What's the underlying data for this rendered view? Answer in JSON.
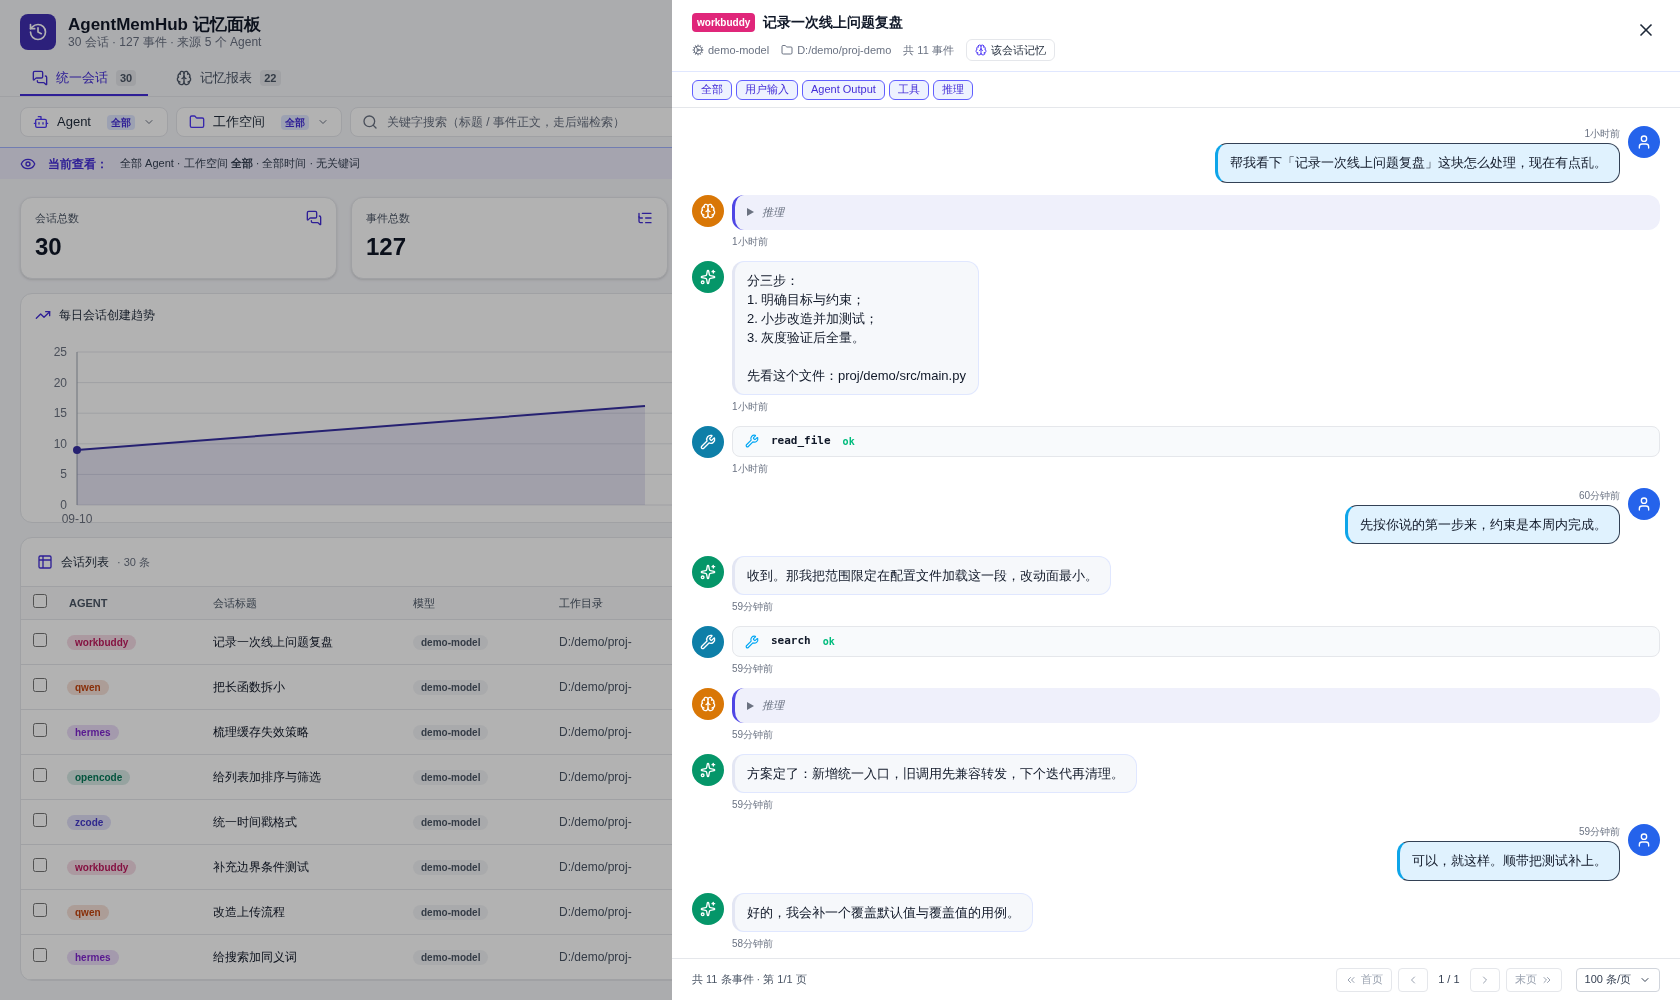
{
  "app": {
    "title": "AgentMemHub 记忆面板",
    "subtitle": "30 会话 · 127 事件 · 来源 5 个 Agent"
  },
  "tabs": [
    {
      "label": "统一会话",
      "count": "30",
      "selected": true
    },
    {
      "label": "记忆报表",
      "count": "22",
      "selected": false
    }
  ],
  "filters": [
    {
      "kind": "agent",
      "label": "Agent",
      "value": "全部"
    },
    {
      "kind": "workspace",
      "label": "工作空间",
      "value": "全部"
    }
  ],
  "search": {
    "placeholder": "关键字搜索（标题 / 事件正文，走后端检索）"
  },
  "viewing": {
    "label": "当前查看：",
    "text": "全部 Agent · 工作空间 **全部** · 全部时间 · 无关键词"
  },
  "stats": [
    {
      "kind": "sessions",
      "label": "会话总数",
      "value": "30"
    },
    {
      "kind": "events",
      "label": "事件总数",
      "value": "127"
    }
  ],
  "trend": {
    "title": "每日会话创建趋势",
    "y_axis_labels": [
      "25",
      "20",
      "15",
      "10",
      "5",
      "0"
    ],
    "x_axis_labels": [
      "09-10"
    ]
  },
  "sessions": {
    "title": "会话列表",
    "count": "· 30 条",
    "select_all": {
      "checked": false
    },
    "columns": [
      "AGENT",
      "会话标题",
      "模型",
      "工作目录"
    ],
    "rows": [
      {
        "agent": "workbuddy",
        "color": "#851141",
        "title": "记录一次线上问题复盘",
        "model": "demo-model",
        "dir": "D:/demo/proj-",
        "checked": false
      },
      {
        "agent": "qwen",
        "color": "#882e08",
        "title": "把长函数拆小",
        "model": "demo-model",
        "dir": "D:/demo/proj-",
        "checked": false
      },
      {
        "agent": "hermes",
        "color": "#581890",
        "title": "梳理缓存失效策略",
        "model": "demo-model",
        "dir": "D:/demo/proj-",
        "checked": false
      },
      {
        "agent": "opencode",
        "color": "#03543d",
        "title": "给列表加排序与筛选",
        "model": "demo-model",
        "dir": "D:/demo/proj-",
        "checked": false
      },
      {
        "agent": "zcode",
        "color": "#2f278d",
        "title": "统一时间戳格式",
        "model": "demo-model",
        "dir": "D:/demo/proj-",
        "checked": false
      },
      {
        "agent": "workbuddy",
        "color": "#851141",
        "title": "补充边界条件测试",
        "model": "demo-model",
        "dir": "D:/demo/proj-",
        "checked": false
      },
      {
        "agent": "qwen",
        "color": "#882e08",
        "title": "改造上传流程",
        "model": "demo-model",
        "dir": "D:/demo/proj-",
        "checked": false
      },
      {
        "agent": "hermes",
        "color": "#581890",
        "title": "给搜索加同义词",
        "model": "demo-model",
        "dir": "D:/demo/proj-",
        "checked": false
      }
    ]
  },
  "drawer": {
    "agent": "workbuddy",
    "title": "记录一次线上问题复盘",
    "model": "demo-model",
    "dir": "D:/demo/proj-demo",
    "events": "共 11 事件",
    "memory_button": "该会话记忆",
    "chips": [
      "全部",
      "用户输入",
      "Agent Output",
      "工具",
      "推理"
    ],
    "messages": [
      {
        "kind": "user",
        "text": "帮我看下「记录一次线上问题复盘」这块怎么处理，现在有点乱。",
        "time": "1小时前"
      },
      {
        "kind": "reasoning",
        "text": "推理",
        "time": "1小时前"
      },
      {
        "kind": "assistant",
        "paragraphs": [
          [
            "分三步：",
            "1. 明确目标与约束；",
            "2. 小步改造并加测试；",
            "3. 灰度验证后全量。"
          ],
          [
            "先看这个文件：proj/demo/src/main.py"
          ]
        ],
        "time": "1小时前"
      },
      {
        "kind": "tool",
        "name": "read_file",
        "status": "ok",
        "time": "1小时前"
      },
      {
        "kind": "user",
        "text": "先按你说的第一步来，约束是本周内完成。",
        "time": "60分钟前"
      },
      {
        "kind": "assistant",
        "paragraphs": [
          [
            "收到。那我把范围限定在配置文件加载这一段，改动面最小。"
          ]
        ],
        "time": "59分钟前"
      },
      {
        "kind": "tool",
        "name": "search",
        "status": "ok",
        "time": "59分钟前"
      },
      {
        "kind": "reasoning",
        "text": "推理",
        "time": "59分钟前"
      },
      {
        "kind": "assistant",
        "paragraphs": [
          [
            "方案定了：新增统一入口，旧调用先兼容转发，下个迭代再清理。"
          ]
        ],
        "time": "59分钟前"
      },
      {
        "kind": "user",
        "text": "可以，就这样。顺带把测试补上。",
        "time": "59分钟前"
      },
      {
        "kind": "assistant",
        "paragraphs": [
          [
            "好的，我会补一个覆盖默认值与覆盖值的用例。"
          ]
        ],
        "time": "58分钟前"
      }
    ],
    "footer": {
      "summary": "共 11 条事件 · 第 1/1 页",
      "first": {
        "label": "首页",
        "disabled": true
      },
      "prev": {
        "disabled": true
      },
      "page": "1 / 1",
      "next": {
        "disabled": true
      },
      "last": {
        "label": "末页",
        "disabled": true
      },
      "page_size": "100 条/页"
    }
  }
}
